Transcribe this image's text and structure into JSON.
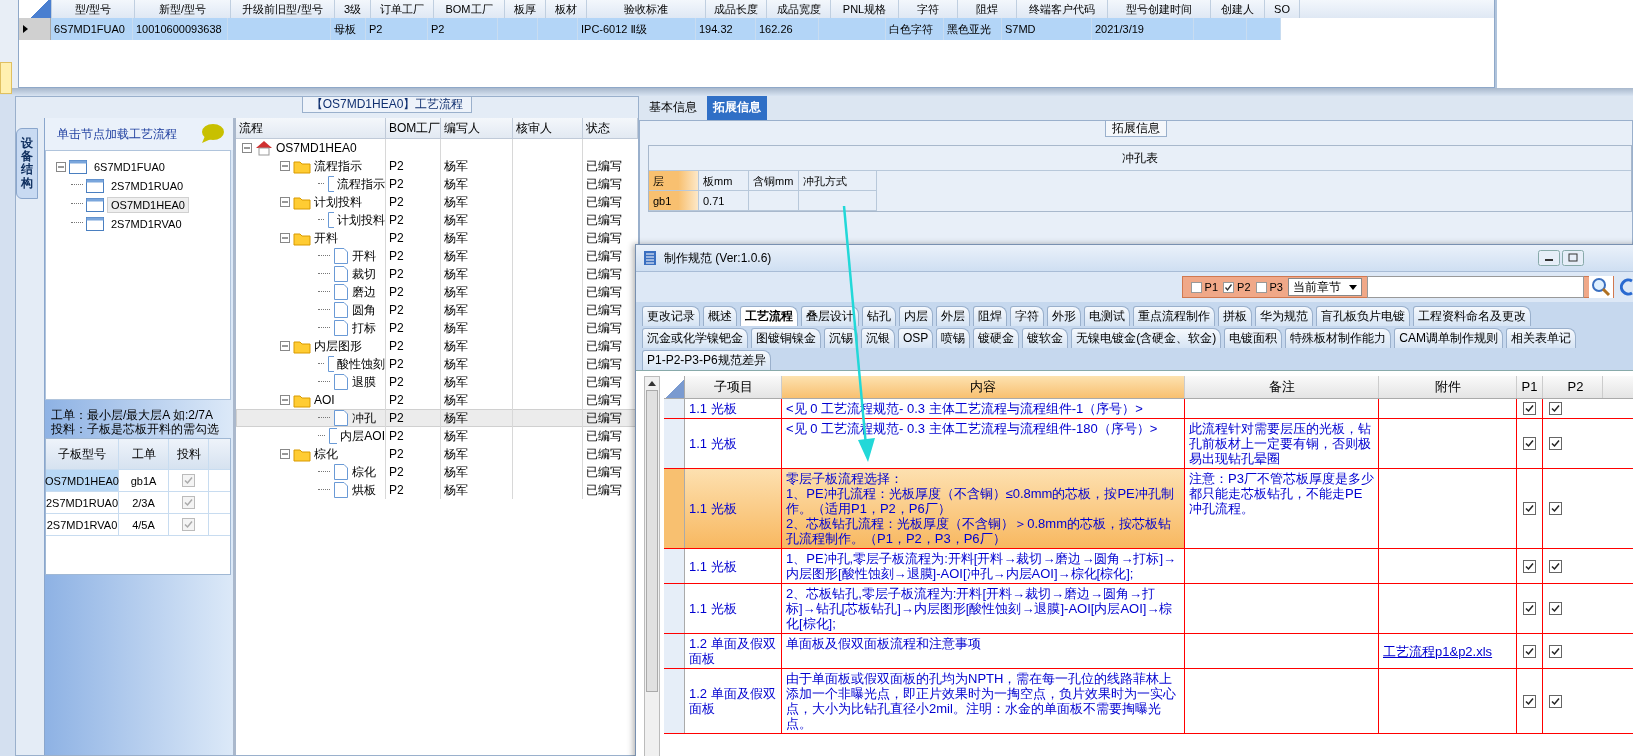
{
  "main_grid": {
    "columns": [
      "型/型号",
      "新型/型号",
      "升级前旧型/型号",
      "3级",
      "订单工厂",
      "BOM工厂",
      "板厚",
      "板材",
      "验收标准",
      "成品长度",
      "成品宽度",
      "PNL规格",
      "字符",
      "阻焊",
      "终端客户代码",
      "型号创建时间",
      "创建人",
      "SO"
    ],
    "rows": [
      {
        "selected": true,
        "cells": [
          "6S7MD1FUA0",
          "10010600093638",
          "",
          "母板",
          "P2",
          "P2",
          "",
          "",
          "IPC-6012 Ⅱ级",
          "194.32",
          "162.26",
          "",
          "白色字符",
          "黑色亚光",
          "S7MD",
          "2021/3/19",
          "",
          ""
        ]
      }
    ]
  },
  "process_panel": {
    "title": "【OS7MD1HEA0】工艺流程",
    "side_tab": "设备结构",
    "tree_hint": "单击节点加载工艺流程",
    "board_tree": {
      "label": "6S7MD1FUA0",
      "expanded": true,
      "children": [
        {
          "label": "2S7MD1RUA0",
          "selected": false
        },
        {
          "label": "OS7MD1HEA0",
          "selected": true
        },
        {
          "label": "2S7MD1RVA0",
          "selected": false
        }
      ]
    },
    "notes": [
      "工单：最小层/最大层A 如:2/7A",
      "投料：子板是芯板开料的需勾选"
    ],
    "sub_table": {
      "columns": [
        "子板型号",
        "工单",
        "投料"
      ],
      "rows": [
        {
          "model": "OS7MD1HEA0",
          "order": "gb1A",
          "checked": true,
          "selected": true
        },
        {
          "model": "2S7MD1RUA0",
          "order": "2/3A",
          "checked": true,
          "selected": false
        },
        {
          "model": "2S7MD1RVA0",
          "order": "4/5A",
          "checked": true,
          "selected": false
        }
      ]
    }
  },
  "flow_grid": {
    "columns": [
      "流程",
      "BOM工厂",
      "编写人",
      "核审人",
      "状态"
    ],
    "root": {
      "label": "OS7MD1HEA0",
      "expanded": true,
      "children": [
        {
          "label": "流程指示",
          "factory": "P2",
          "writer": "杨军",
          "status": "已编写",
          "expanded": true,
          "children": [
            {
              "label": "流程指示",
              "factory": "P2",
              "writer": "杨军",
              "status": "已编写",
              "selected": false
            }
          ]
        },
        {
          "label": "计划投料",
          "factory": "P2",
          "writer": "杨军",
          "status": "已编写",
          "expanded": true,
          "children": [
            {
              "label": "计划投料",
              "factory": "P2",
              "writer": "杨军",
              "status": "已编写",
              "selected": false
            }
          ]
        },
        {
          "label": "开料",
          "factory": "P2",
          "writer": "杨军",
          "status": "已编写",
          "expanded": true,
          "children": [
            {
              "label": "开料",
              "factory": "P2",
              "writer": "杨军",
              "status": "已编写",
              "selected": false
            },
            {
              "label": "裁切",
              "factory": "P2",
              "writer": "杨军",
              "status": "已编写",
              "selected": false
            },
            {
              "label": "磨边",
              "factory": "P2",
              "writer": "杨军",
              "status": "已编写",
              "selected": false
            },
            {
              "label": "圆角",
              "factory": "P2",
              "writer": "杨军",
              "status": "已编写",
              "selected": false
            },
            {
              "label": "打标",
              "factory": "P2",
              "writer": "杨军",
              "status": "已编写",
              "selected": false
            }
          ]
        },
        {
          "label": "内层图形",
          "factory": "P2",
          "writer": "杨军",
          "status": "已编写",
          "expanded": true,
          "children": [
            {
              "label": "酸性蚀刻",
              "factory": "P2",
              "writer": "杨军",
              "status": "已编写",
              "selected": false
            },
            {
              "label": "退膜",
              "factory": "P2",
              "writer": "杨军",
              "status": "已编写",
              "selected": false
            }
          ]
        },
        {
          "label": "AOI",
          "factory": "P2",
          "writer": "杨军",
          "status": "已编写",
          "expanded": true,
          "children": [
            {
              "label": "冲孔",
              "factory": "P2",
              "writer": "杨军",
              "status": "已编写",
              "selected": true
            },
            {
              "label": "内层AOI",
              "factory": "P2",
              "writer": "杨军",
              "status": "已编写",
              "selected": false
            }
          ]
        },
        {
          "label": "棕化",
          "factory": "P2",
          "writer": "杨军",
          "status": "已编写",
          "expanded": true,
          "children": [
            {
              "label": "棕化",
              "factory": "P2",
              "writer": "杨军",
              "status": "已编写",
              "selected": false
            },
            {
              "label": "烘板",
              "factory": "P2",
              "writer": "杨军",
              "status": "已编写",
              "selected": false
            }
          ]
        }
      ]
    }
  },
  "info_tabs": [
    {
      "label": "基本信息",
      "selected": false
    },
    {
      "label": "拓展信息",
      "selected": true
    }
  ],
  "ext_group": {
    "title": "拓展信息",
    "table_title": "冲孔表",
    "columns": [
      "层",
      "板mm",
      "含铜mm",
      "冲孔方式"
    ],
    "rows": [
      {
        "layer": "gb1",
        "board": "0.71"
      }
    ]
  },
  "spec_window": {
    "title": "制作规范 (Ver:1.0.6)",
    "filters": [
      {
        "label": "P1",
        "checked": false
      },
      {
        "label": "P2",
        "checked": true
      },
      {
        "label": "P3",
        "checked": false
      }
    ],
    "chapter": "当前章节",
    "tab_rows": [
      [
        {
          "label": "更改记录",
          "selected": false
        },
        {
          "label": "概述",
          "selected": false
        },
        {
          "label": "工艺流程",
          "selected": true
        },
        {
          "label": "叠层设计",
          "selected": false
        },
        {
          "label": "钻孔",
          "selected": false
        },
        {
          "label": "内层",
          "selected": false
        },
        {
          "label": "外层",
          "selected": false
        },
        {
          "label": "阻焊",
          "selected": false
        },
        {
          "label": "字符",
          "selected": false
        },
        {
          "label": "外形",
          "selected": false
        },
        {
          "label": "电测试",
          "selected": false
        },
        {
          "label": "重点流程制作",
          "selected": false
        },
        {
          "label": "拼板",
          "selected": false
        },
        {
          "label": "华为规范",
          "selected": false
        },
        {
          "label": "盲孔板负片电镀",
          "selected": false
        },
        {
          "label": "工程资料命名及更改",
          "selected": false
        }
      ],
      [
        {
          "label": "沉金或化学镍钯金",
          "selected": false
        },
        {
          "label": "图镀铜镍金",
          "selected": false
        },
        {
          "label": "沉锡",
          "selected": false
        },
        {
          "label": "沉银",
          "selected": false
        },
        {
          "label": "OSP",
          "selected": false
        },
        {
          "label": "喷锡",
          "selected": false
        },
        {
          "label": "镀硬金",
          "selected": false
        },
        {
          "label": "镀软金",
          "selected": false
        },
        {
          "label": "无镍电镀金(含硬金、软金)",
          "selected": false
        },
        {
          "label": "电镀面积",
          "selected": false
        },
        {
          "label": "特殊板材制作能力",
          "selected": false
        },
        {
          "label": "CAM调单制作规则",
          "selected": false
        },
        {
          "label": "相关表单记",
          "selected": false
        }
      ],
      [
        {
          "label": "P1-P2-P3-P6规范差异",
          "selected": false
        }
      ]
    ],
    "table": {
      "columns": [
        "子项目",
        "内容",
        "备注",
        "附件",
        "P1",
        "P2"
      ],
      "rows": [
        {
          "item": "1.1 光板",
          "content": "<见 0 工艺流程规范- 0.3 主体工艺流程与流程组件-1（序号）>",
          "p1": true,
          "p2": true,
          "selected": false
        },
        {
          "item": "1.1 光板",
          "content": "<见 0 工艺流程规范- 0.3 主体工艺流程与流程组件-180（序号）>",
          "note": "此流程针对需要层压的光板，钻孔前板材上一定要有铜，否则极易出现钻孔晕圈",
          "p1": true,
          "p2": true,
          "selected": false
        },
        {
          "item": "1.1 光板",
          "content": "零层子板流程选择：\n1、PE冲孔流程：光板厚度（不含铜）≤0.8mm的芯板，按PE冲孔制作。（适用P1，P2，P6厂）\n2、芯板钻孔流程：光板厚度（不含铜）＞0.8mm的芯板，按芯板钻孔流程制作。（P1，P2，P3，P6厂）",
          "note": "注意：P3厂不管芯板厚度是多少都只能走芯板钻孔，不能走PE冲孔流程。",
          "p1": true,
          "p2": true,
          "selected": true
        },
        {
          "item": "1.1 光板",
          "content": "1、PE冲孔,零层子板流程为:开料[开料→裁切→磨边→圆角→打标]→内层图形[酸性蚀刻→退膜]-AOI[冲孔→内层AOI]→棕化[棕化];",
          "p1": true,
          "p2": true,
          "selected": false
        },
        {
          "item": "1.1 光板",
          "content": "2、芯板钻孔,零层子板流程为:开料[开料→裁切→磨边→圆角→打标]→钻孔[芯板钻孔]→内层图形[酸性蚀刻→退膜]-AOI[内层AOI]→棕化[棕化];",
          "p1": true,
          "p2": true,
          "selected": false
        },
        {
          "item": "1.2 单面及假双面板",
          "content": "单面板及假双面板流程和注意事项",
          "attachment": "工艺流程p1&p2.xls",
          "p1": true,
          "p2": true,
          "selected": false
        },
        {
          "item": "1.2 单面及假双面板",
          "content": "由于单面板或假双面板的孔均为NPTH，需在每一孔位的线路菲林上添加一个非曝光点，即正片效果时为一掏空点，负片效果时为一实心点，大小为比钻孔直径小2mil。注明：水金的单面板不需要掏曝光点。",
          "p1": true,
          "p2": true,
          "selected": false
        }
      ]
    }
  }
}
